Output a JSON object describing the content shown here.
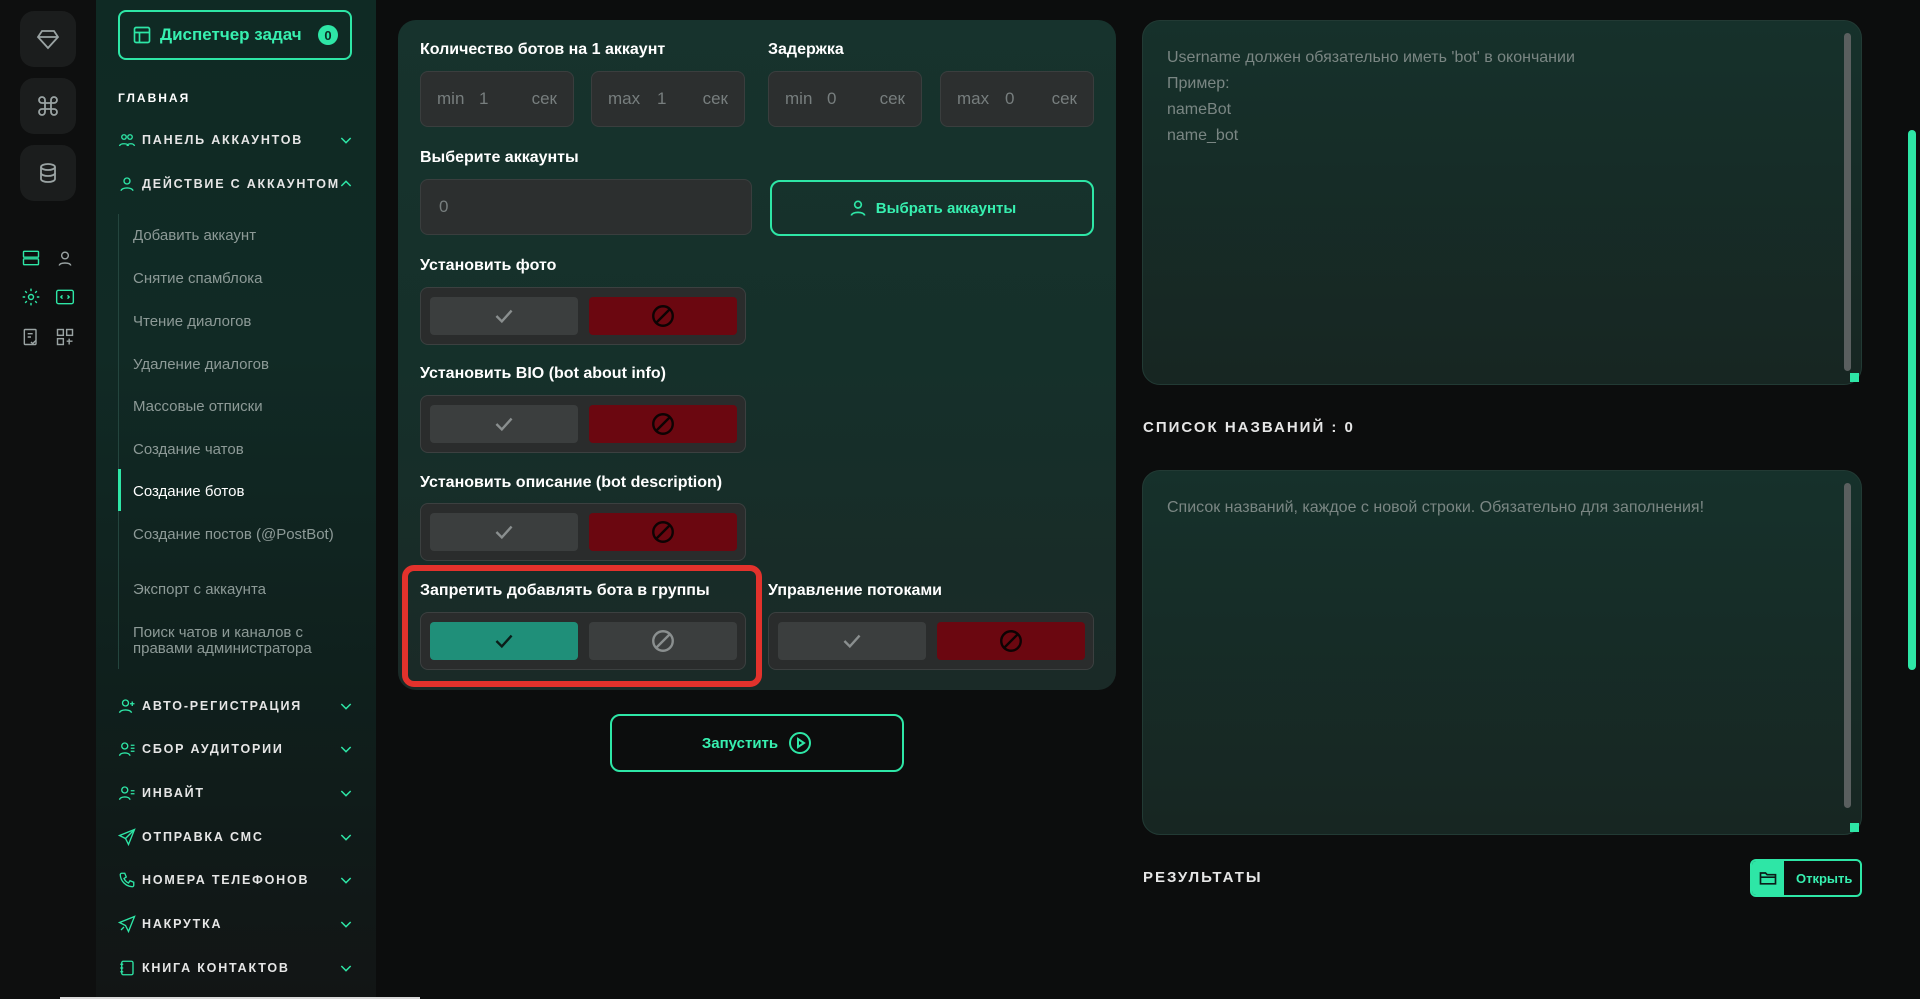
{
  "rail": {
    "icons": [
      "diamond-icon",
      "command-icon",
      "database-icon",
      "server-icon",
      "profile-icon",
      "settings-icon",
      "code-icon",
      "tasks-icon",
      "grid-icon"
    ]
  },
  "sidebar": {
    "task_manager_label": "Диспетчер задач",
    "task_manager_count": "0",
    "main_heading": "ГЛАВНАЯ",
    "groups_top": [
      {
        "label": "ПАНЕЛЬ АККАУНТОВ"
      },
      {
        "label": "ДЕЙСТВИЕ С АККАУНТОМ"
      }
    ],
    "sub_items": [
      "Добавить аккаунт",
      "Снятие спамблока",
      "Чтение диалогов",
      "Удаление диалогов",
      "Массовые отписки",
      "Создание чатов",
      "Создание ботов",
      "Создание постов (@PostBot)",
      "Экспорт с аккаунта",
      "Поиск чатов и каналов с правами администратора"
    ],
    "active_item": "Создание ботов",
    "groups_bottom": [
      {
        "label": "АВТО-РЕГИСТРАЦИЯ"
      },
      {
        "label": "СБОР АУДИТОРИИ"
      },
      {
        "label": "ИНВАЙТ"
      },
      {
        "label": "ОТПРАВКА СМС"
      },
      {
        "label": "НОМЕРА ТЕЛЕФОНОВ"
      },
      {
        "label": "НАКРУТКА"
      },
      {
        "label": "КНИГА КОНТАКТОВ"
      }
    ]
  },
  "form": {
    "bots_per_account_label": "Количество ботов на 1 аккаунт",
    "bots_min_prefix": "min",
    "bots_min_value": "1",
    "bots_max_prefix": "max",
    "bots_max_value": "1",
    "unit": "сек",
    "delay_label": "Задержка",
    "delay_min_prefix": "min",
    "delay_min_value": "0",
    "delay_max_prefix": "max",
    "delay_max_value": "0",
    "select_accounts_label": "Выберите аккаунты",
    "accounts_count": "0",
    "pick_accounts_button": "Выбрать аккаунты",
    "set_photo_label": "Установить фото",
    "set_bio_label": "Установить BIO (bot about info)",
    "set_description_label": "Установить описание (bot description)",
    "forbid_groups_label": "Запретить добавлять бота в группы",
    "threads_label": "Управление потоками",
    "run_button": "Запустить"
  },
  "right": {
    "username_hint": "Username должен обязательно иметь 'bot' в окончании\nПример:\nnameBot\nname_bot",
    "names_heading": "СПИСОК НАЗВАНИЙ : 0",
    "names_placeholder": "Список названий, каждое с новой строки. Обязательно для заполнения!",
    "results_heading": "РЕЗУЛЬТАТЫ",
    "open_button": "Открыть"
  },
  "colors": {
    "accent": "#2ee6a6",
    "danger": "#6b0710",
    "highlight": "#e2322c"
  }
}
